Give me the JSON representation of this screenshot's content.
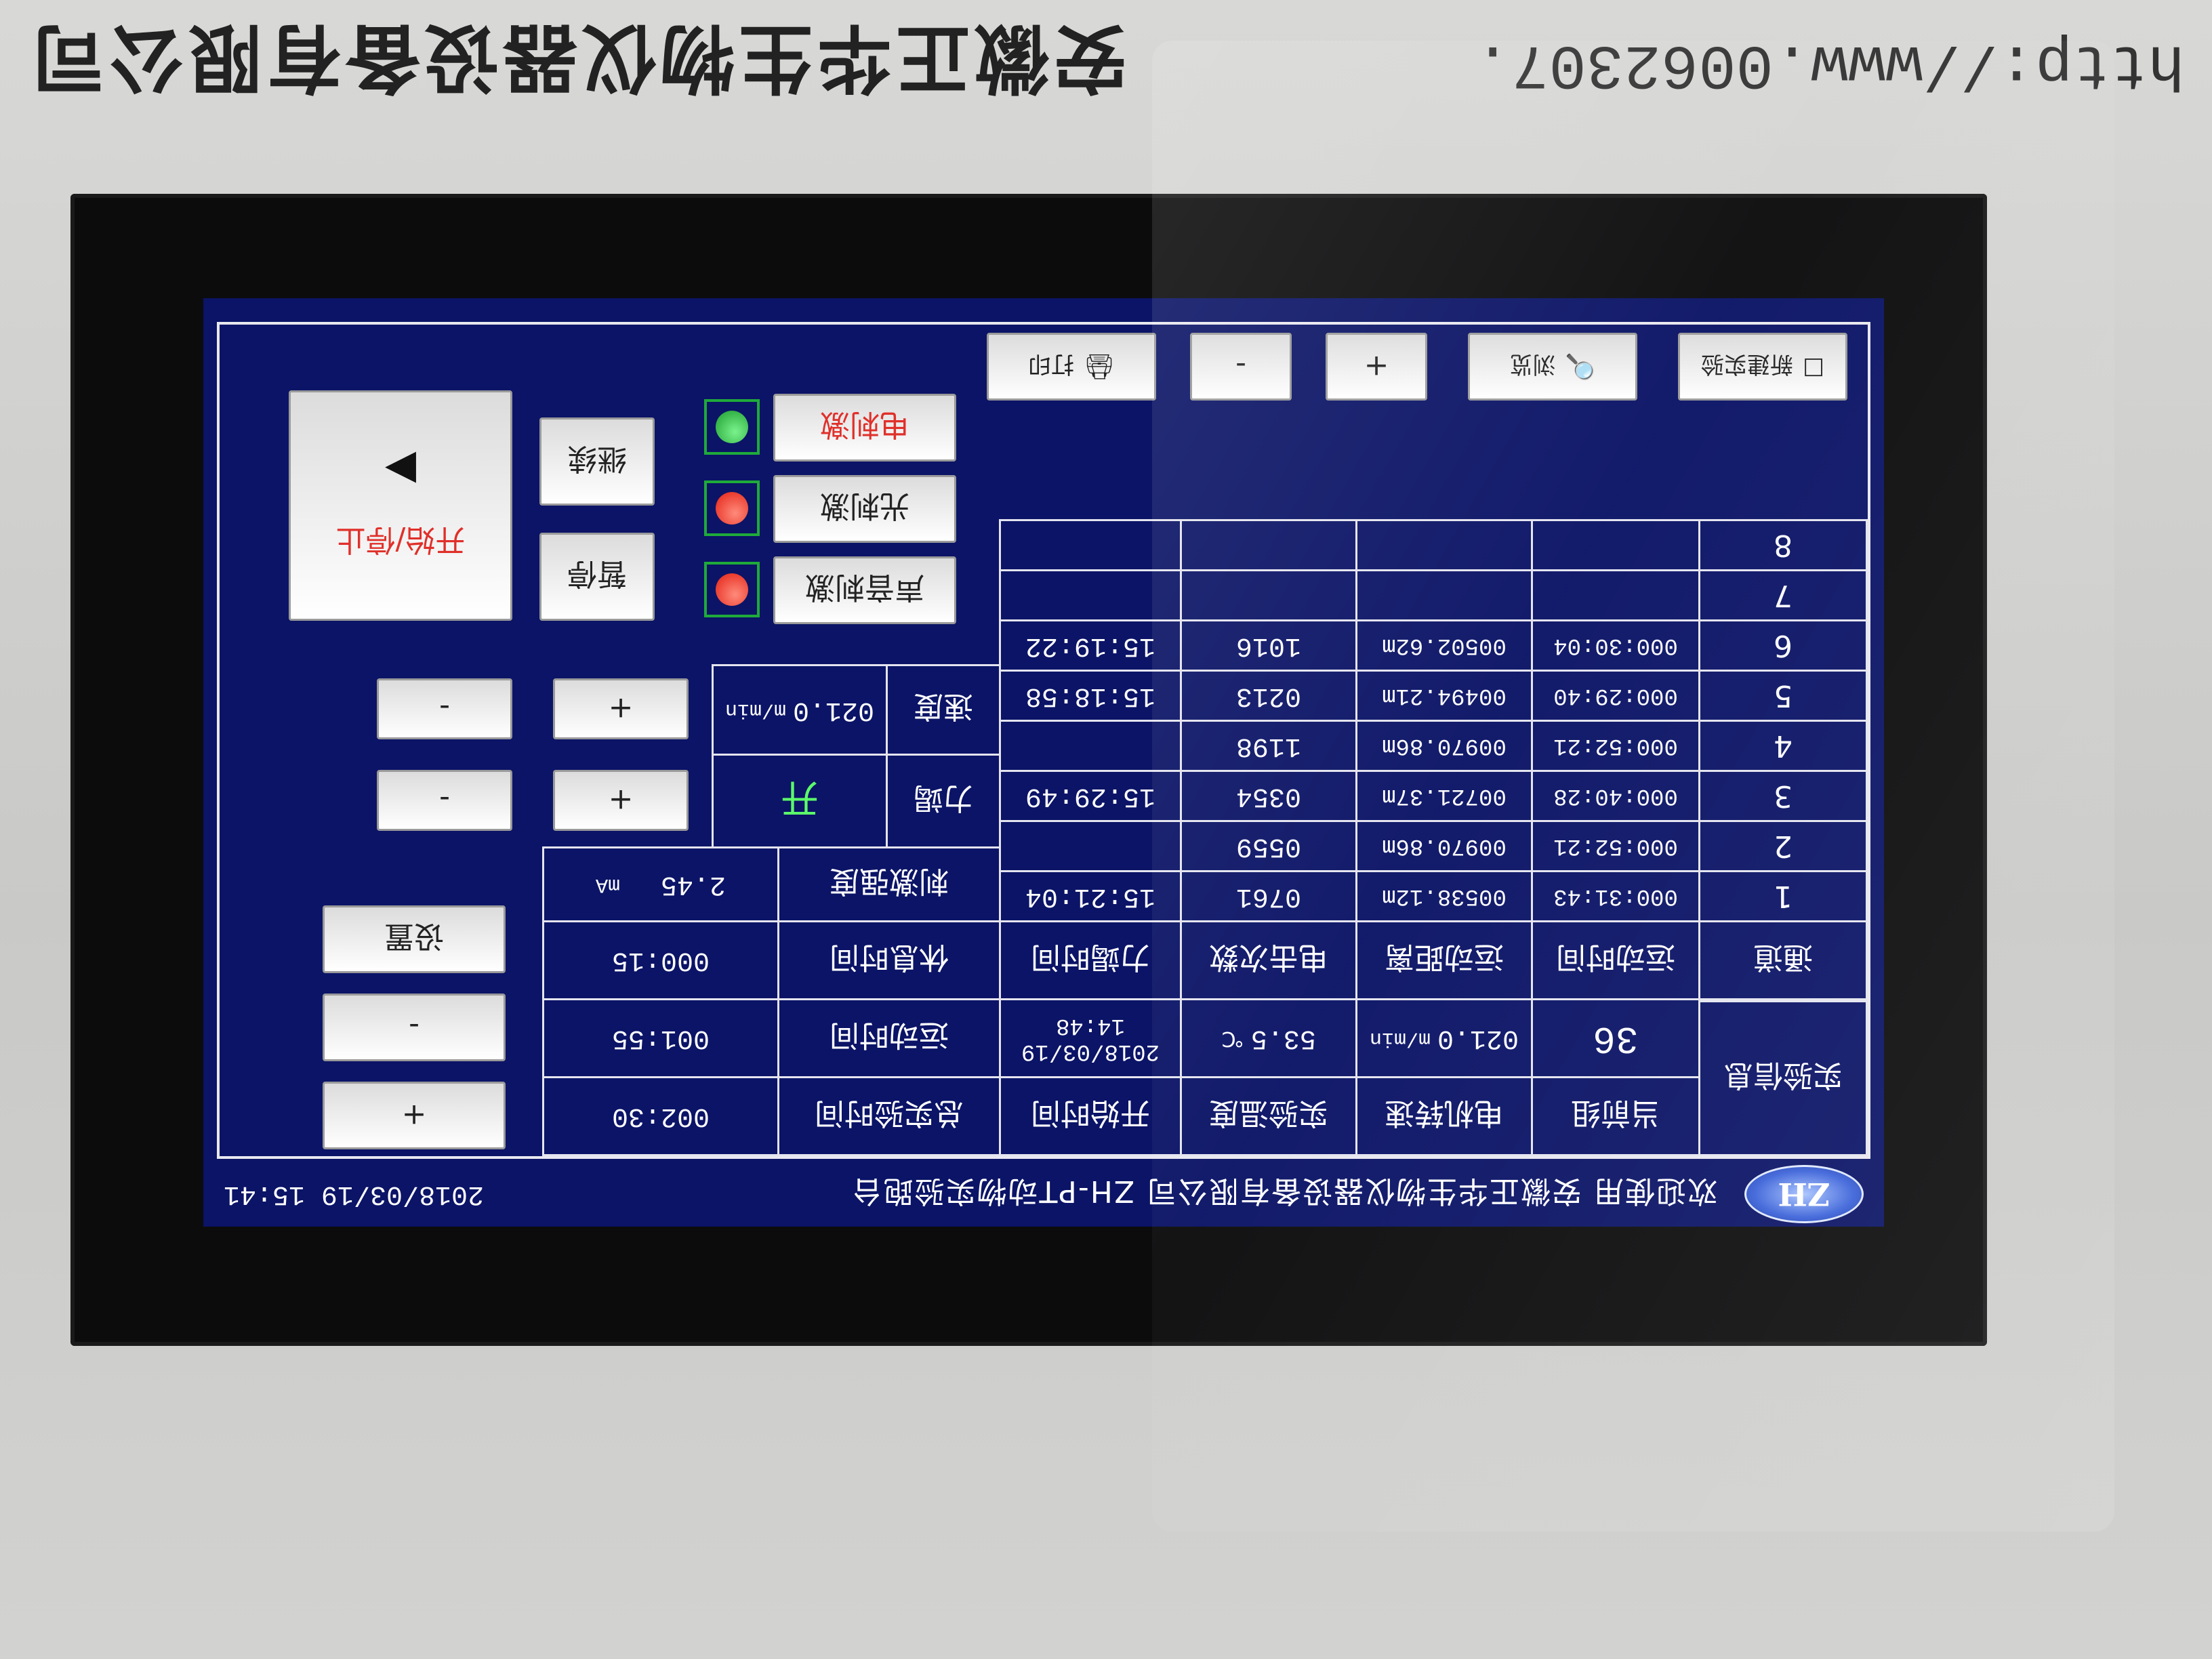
{
  "case_label": {
    "company": "安徽正华生物仪器设备有限公司",
    "url": "http://www.0062307."
  },
  "header": {
    "logo_text": "ZH",
    "welcome": "欢迎使用  安徽正华生物仪器设备有限公司  ZH-PT动物实验跑台",
    "datetime": "2018/03/19  15:41"
  },
  "experiment_info": {
    "section_label": "实验信息",
    "headers": [
      "当前组",
      "电机转速",
      "实验温度",
      "开始时间",
      "总实验时间"
    ],
    "current_group": "36",
    "motor_speed": "021.0",
    "motor_speed_unit": "m/min",
    "temperature": "53.5",
    "temperature_unit": "℃",
    "start_time": "2018/03/19 14:48",
    "total_time": "002:30"
  },
  "settings": {
    "run_time_label": "运动时间",
    "run_time": "001:55",
    "rest_time_label": "休息时间",
    "rest_time": "000:15",
    "stim_strength_label": "刺激强度",
    "stim_strength": "2.45",
    "stim_strength_unit": "mA",
    "plus_label": "+",
    "minus_label": "-",
    "set_label": "设置"
  },
  "channel_table": {
    "headers": [
      "通道",
      "运动时间",
      "运动距离",
      "电击次数",
      "力竭时间"
    ],
    "rows": [
      {
        "ch": "1",
        "time": "000:31:43",
        "dist": "00538.12m",
        "shocks": "0761",
        "exhaust": "15:21:04"
      },
      {
        "ch": "2",
        "time": "000:52:21",
        "dist": "00970.86m",
        "shocks": "0559",
        "exhaust": ""
      },
      {
        "ch": "3",
        "time": "000:40:28",
        "dist": "00721.37m",
        "shocks": "0354",
        "exhaust": "15:29:49"
      },
      {
        "ch": "4",
        "time": "000:52:21",
        "dist": "00970.86m",
        "shocks": "1198",
        "exhaust": ""
      },
      {
        "ch": "5",
        "time": "000:29:40",
        "dist": "00494.21m",
        "shocks": "0213",
        "exhaust": "15:18:58"
      },
      {
        "ch": "6",
        "time": "000:30:04",
        "dist": "00502.62m",
        "shocks": "1016",
        "exhaust": "15:19:22"
      },
      {
        "ch": "7",
        "time": "",
        "dist": "",
        "shocks": "",
        "exhaust": ""
      },
      {
        "ch": "8",
        "time": "",
        "dist": "",
        "shocks": "",
        "exhaust": ""
      }
    ]
  },
  "speed_control": {
    "exhaust_label": "力竭",
    "exhaust_value": "开",
    "speed_label": "速度",
    "speed_value": "021.0",
    "speed_unit": "m/min",
    "plus_label": "+",
    "minus_label": "-"
  },
  "toolbar": {
    "new_experiment": "新建实验",
    "browse": "浏览",
    "plus": "+",
    "minus": "-",
    "print": "打印"
  },
  "stimulus": {
    "electric": "电刺激",
    "light": "光刺激",
    "sound": "声音刺激",
    "electric_lamp": "green",
    "light_lamp": "red",
    "sound_lamp": "red"
  },
  "run_controls": {
    "start_stop": "开始/停止",
    "continue": "继续",
    "pause": "暂停"
  }
}
